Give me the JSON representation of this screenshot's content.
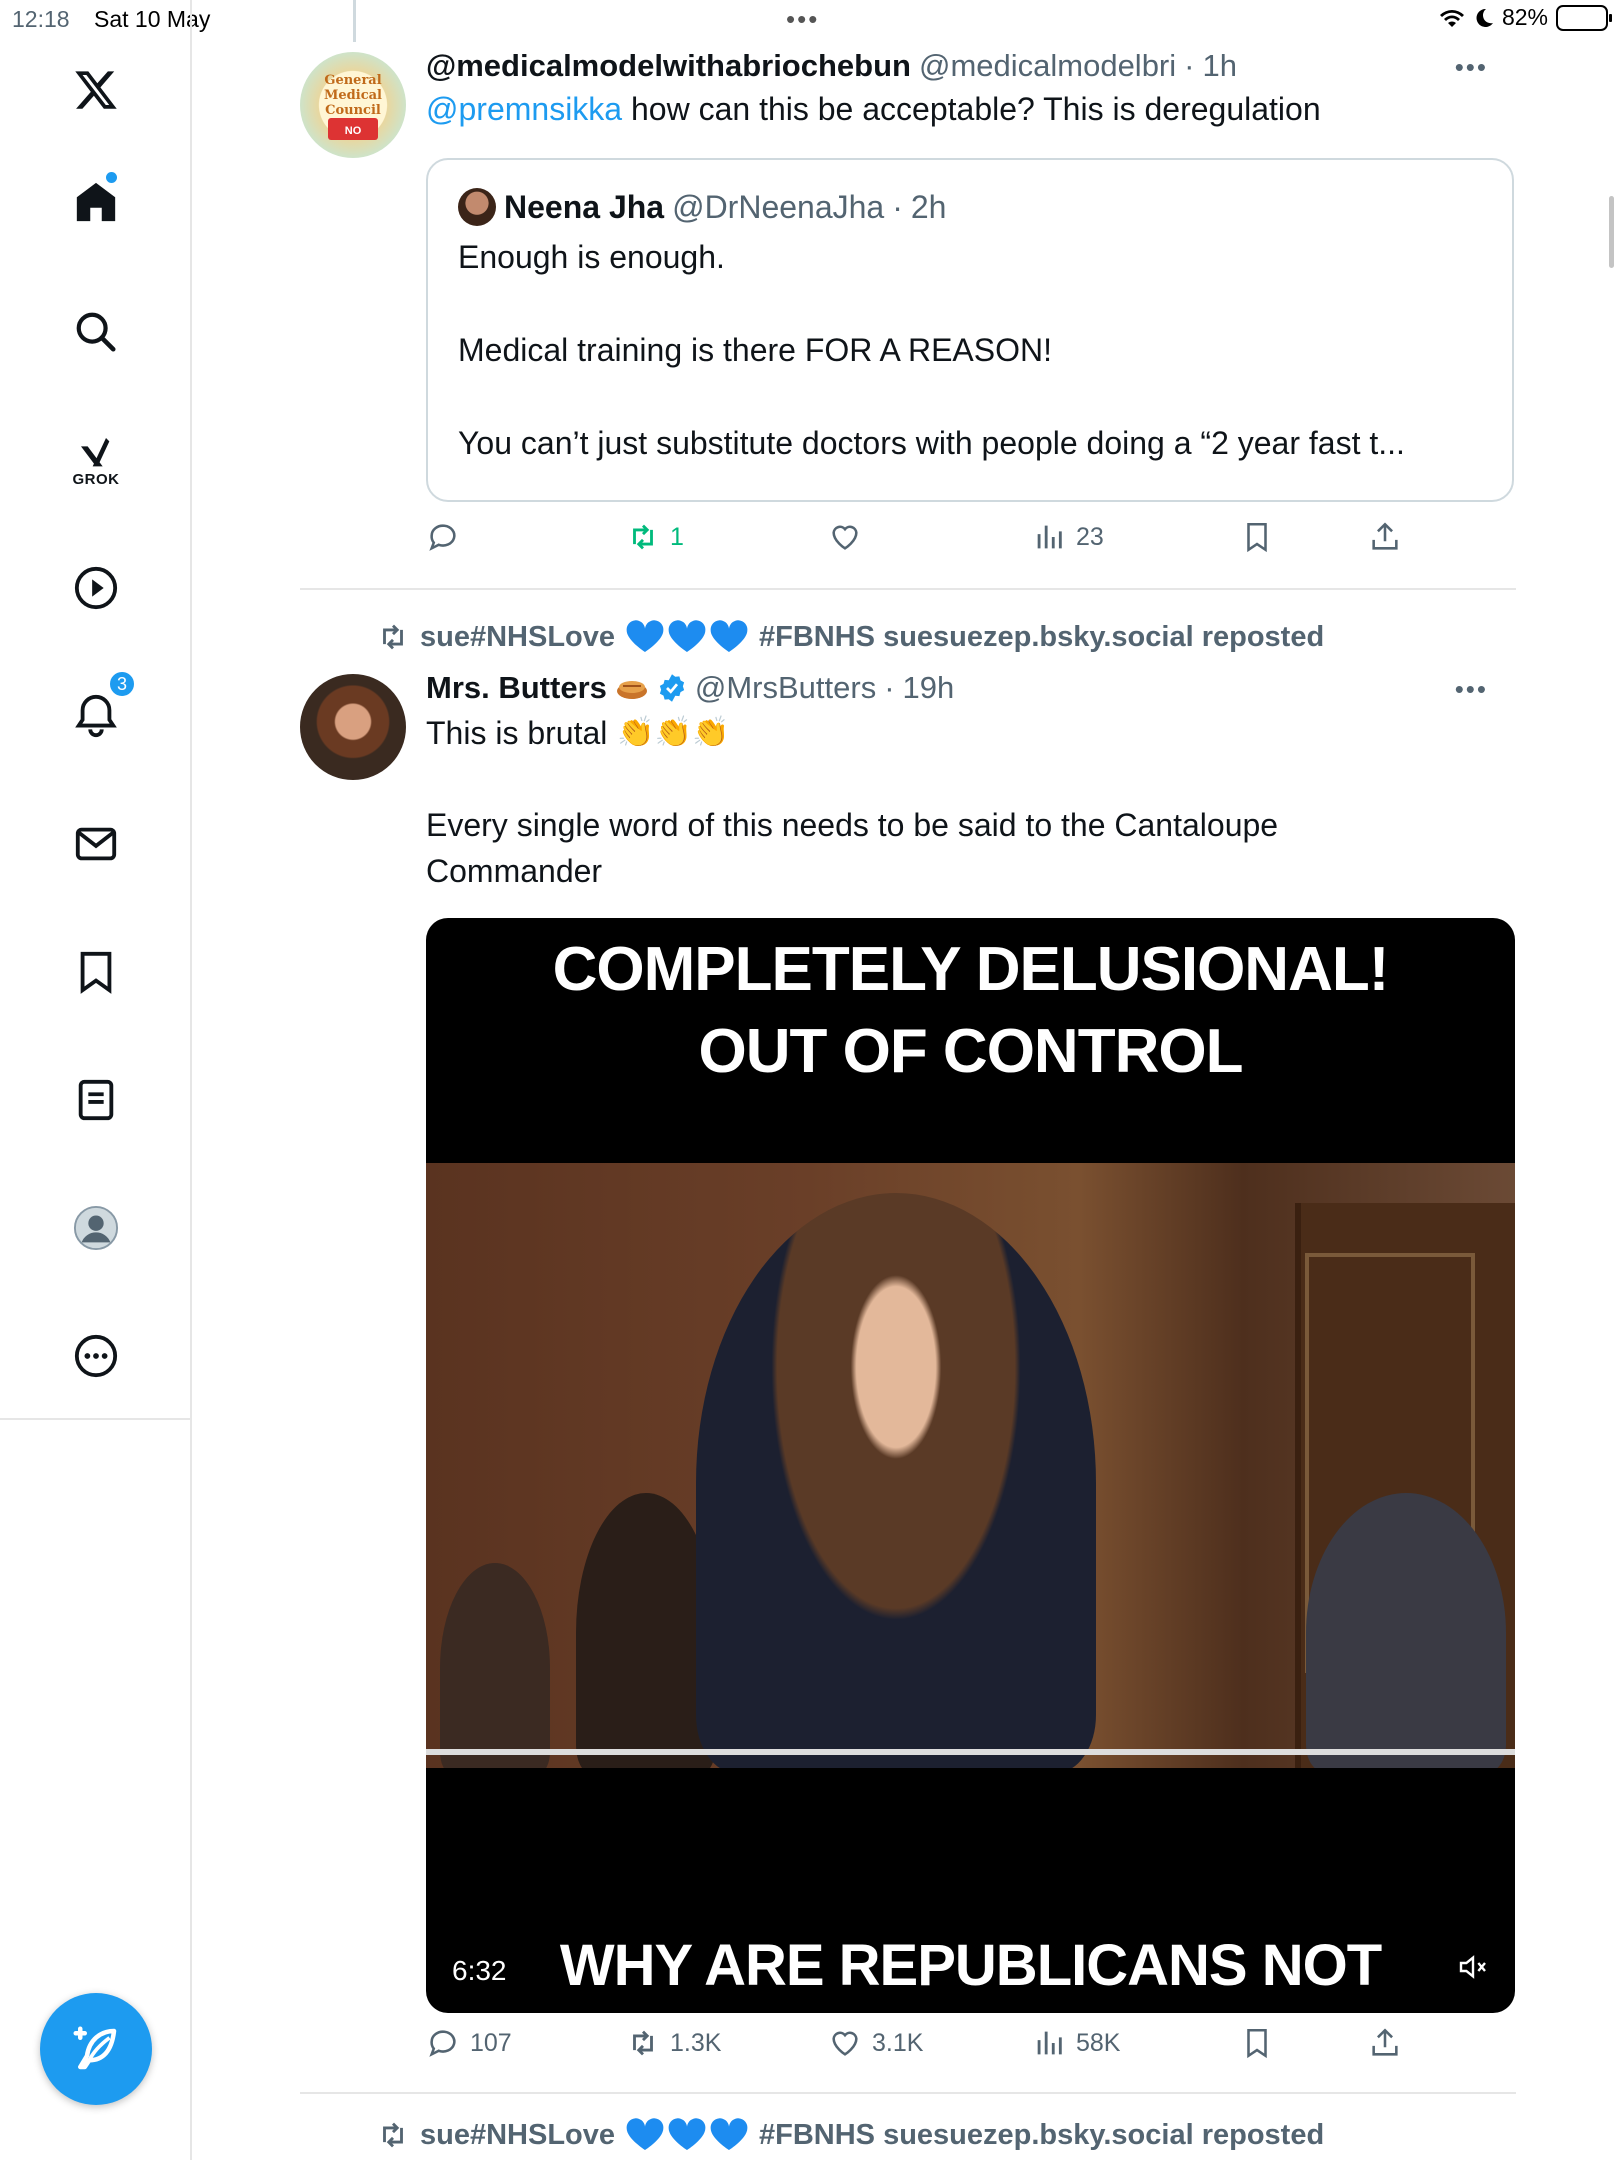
{
  "status_bar": {
    "time": "12:18",
    "date": "Sat 10 May",
    "battery": "82%",
    "battery_level": 0.82
  },
  "sidebar": {
    "items": [
      {
        "name": "x-logo-icon"
      },
      {
        "name": "home-icon"
      },
      {
        "name": "search-icon"
      },
      {
        "name": "grok-icon",
        "label": "GROK"
      },
      {
        "name": "video-icon"
      },
      {
        "name": "notifications-icon",
        "badge": "3"
      },
      {
        "name": "messages-icon"
      },
      {
        "name": "bookmarks-icon"
      },
      {
        "name": "lists-icon"
      },
      {
        "name": "profile-icon"
      },
      {
        "name": "more-icon"
      }
    ]
  },
  "tweet1": {
    "name": "@medicalmodelwithabriochebun",
    "handle": "@medicalmodelbri",
    "time": "1h",
    "mention": "@premnsikka",
    "text": " how can this be acceptable? This is deregulation",
    "quote": {
      "name": "Neena Jha",
      "handle": "@DrNeenaJha",
      "time": "2h",
      "line1": "Enough is enough.",
      "line2": "Medical training is there FOR A REASON!",
      "line3": "You can’t just substitute doctors with people doing a “2 year fast t..."
    },
    "retweets": "1",
    "views": "23"
  },
  "tweet2": {
    "repost_by": "sue#NHSLove",
    "repost_suffix": "#FBNHS suesuezep.bsky.social reposted",
    "name": "Mrs. Butters",
    "handle": "@MrsButters",
    "time": "19h",
    "line1": "This is brutal",
    "line2": "Every single word of this needs to be said to the Cantaloupe",
    "line3": "Commander",
    "video": {
      "caption_top1": "COMPLETELY DELUSIONAL!",
      "caption_top2": "OUT OF CONTROL",
      "caption_bottom": "WHY ARE REPUBLICANS NOT",
      "duration": "6:32"
    },
    "replies": "107",
    "retweets": "1.3K",
    "likes": "3.1K",
    "views": "58K"
  },
  "tweet3": {
    "repost_by": "sue#NHSLove",
    "repost_suffix": "#FBNHS suesuezep.bsky.social reposted"
  },
  "colors": {
    "accent": "#1d9bf0",
    "retweet_green": "#00ba7c",
    "muted": "#536471"
  }
}
